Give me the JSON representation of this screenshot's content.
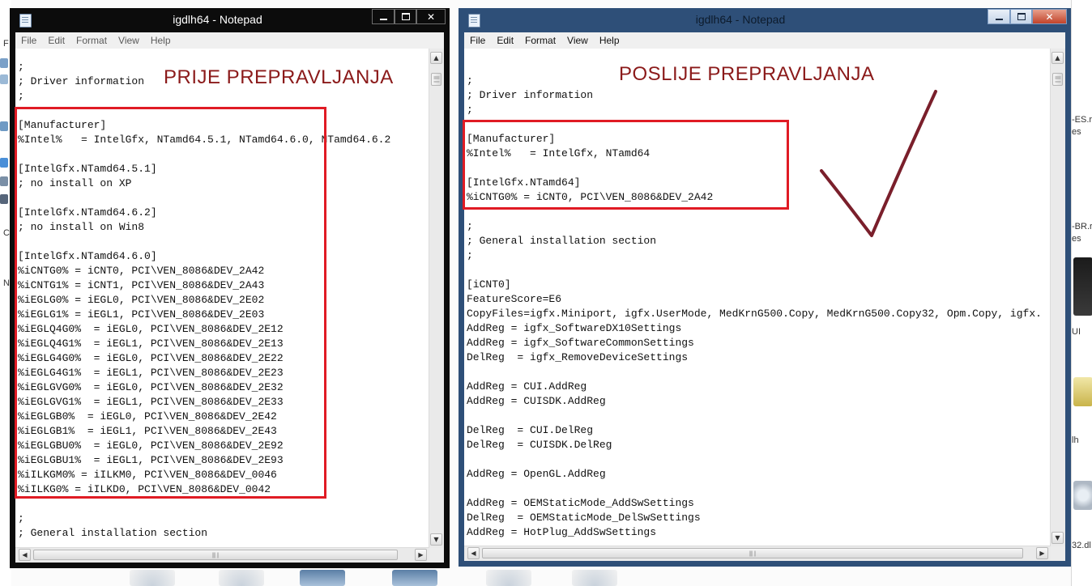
{
  "desktop": {
    "right_strip_labels": [
      "-ES.r",
      "es",
      "-BR.r",
      "es",
      "UI",
      "lh",
      "32.dl"
    ],
    "left_strip_labels": [
      "F",
      "C",
      "N"
    ]
  },
  "windows": [
    {
      "title": "igdlh64 - Notepad",
      "menu": [
        "File",
        "Edit",
        "Format",
        "View",
        "Help"
      ],
      "text": ";\n; Driver information\n;\n\n[Manufacturer]\n%Intel%   = IntelGfx, NTamd64.5.1, NTamd64.6.0, NTamd64.6.2\n\n[IntelGfx.NTamd64.5.1]\n; no install on XP\n\n[IntelGfx.NTamd64.6.2]\n; no install on Win8\n\n[IntelGfx.NTamd64.6.0]\n%iCNTG0% = iCNT0, PCI\\VEN_8086&DEV_2A42\n%iCNTG1% = iCNT1, PCI\\VEN_8086&DEV_2A43\n%iEGLG0% = iEGL0, PCI\\VEN_8086&DEV_2E02\n%iEGLG1% = iEGL1, PCI\\VEN_8086&DEV_2E03\n%iEGLQ4G0%  = iEGL0, PCI\\VEN_8086&DEV_2E12\n%iEGLQ4G1%  = iEGL1, PCI\\VEN_8086&DEV_2E13\n%iEGLG4G0%  = iEGL0, PCI\\VEN_8086&DEV_2E22\n%iEGLG4G1%  = iEGL1, PCI\\VEN_8086&DEV_2E23\n%iEGLGVG0%  = iEGL0, PCI\\VEN_8086&DEV_2E32\n%iEGLGVG1%  = iEGL1, PCI\\VEN_8086&DEV_2E33\n%iEGLGB0%  = iEGL0, PCI\\VEN_8086&DEV_2E42\n%iEGLGB1%  = iEGL1, PCI\\VEN_8086&DEV_2E43\n%iEGLGBU0%  = iEGL0, PCI\\VEN_8086&DEV_2E92\n%iEGLGBU1%  = iEGL1, PCI\\VEN_8086&DEV_2E93\n%iILKGM0% = iILKM0, PCI\\VEN_8086&DEV_0046\n%iILKG0% = iILKD0, PCI\\VEN_8086&DEV_0042\n\n;\n; General installation section",
      "annotation": "PRIJE PREPRAVLJANJA"
    },
    {
      "title": "igdlh64 - Notepad",
      "menu": [
        "File",
        "Edit",
        "Format",
        "View",
        "Help"
      ],
      "text": "\n;\n; Driver information\n;\n\n[Manufacturer]\n%Intel%   = IntelGfx, NTamd64\n\n[IntelGfx.NTamd64]\n%iCNTG0% = iCNT0, PCI\\VEN_8086&DEV_2A42\n\n;\n; General installation section\n;\n\n[iCNT0]\nFeatureScore=E6\nCopyFiles=igfx.Miniport, igfx.UserMode, MedKrnG500.Copy, MedKrnG500.Copy32, Opm.Copy, igfx.\nAddReg = igfx_SoftwareDX10Settings\nAddReg = igfx_SoftwareCommonSettings\nDelReg  = igfx_RemoveDeviceSettings\n\nAddReg = CUI.AddReg\nAddReg = CUISDK.AddReg\n\nDelReg  = CUI.DelReg\nDelReg  = CUISDK.DelReg\n\nAddReg = OpenGL.AddReg\n\nAddReg = OEMStaticMode_AddSwSettings\nDelReg  = OEMStaticMode_DelSwSettings\nAddReg = HotPlug_AddSwSettings",
      "annotation": "POSLIJE PREPRAVLJANJA"
    }
  ],
  "colors": {
    "highlight_box": "#e01b24",
    "annotation_text": "#8b1a1a",
    "checkmark": "#7a1f2b"
  },
  "icons": [
    "notepad-icon",
    "minimize-icon",
    "maximize-icon",
    "close-icon",
    "checkmark-icon"
  ]
}
